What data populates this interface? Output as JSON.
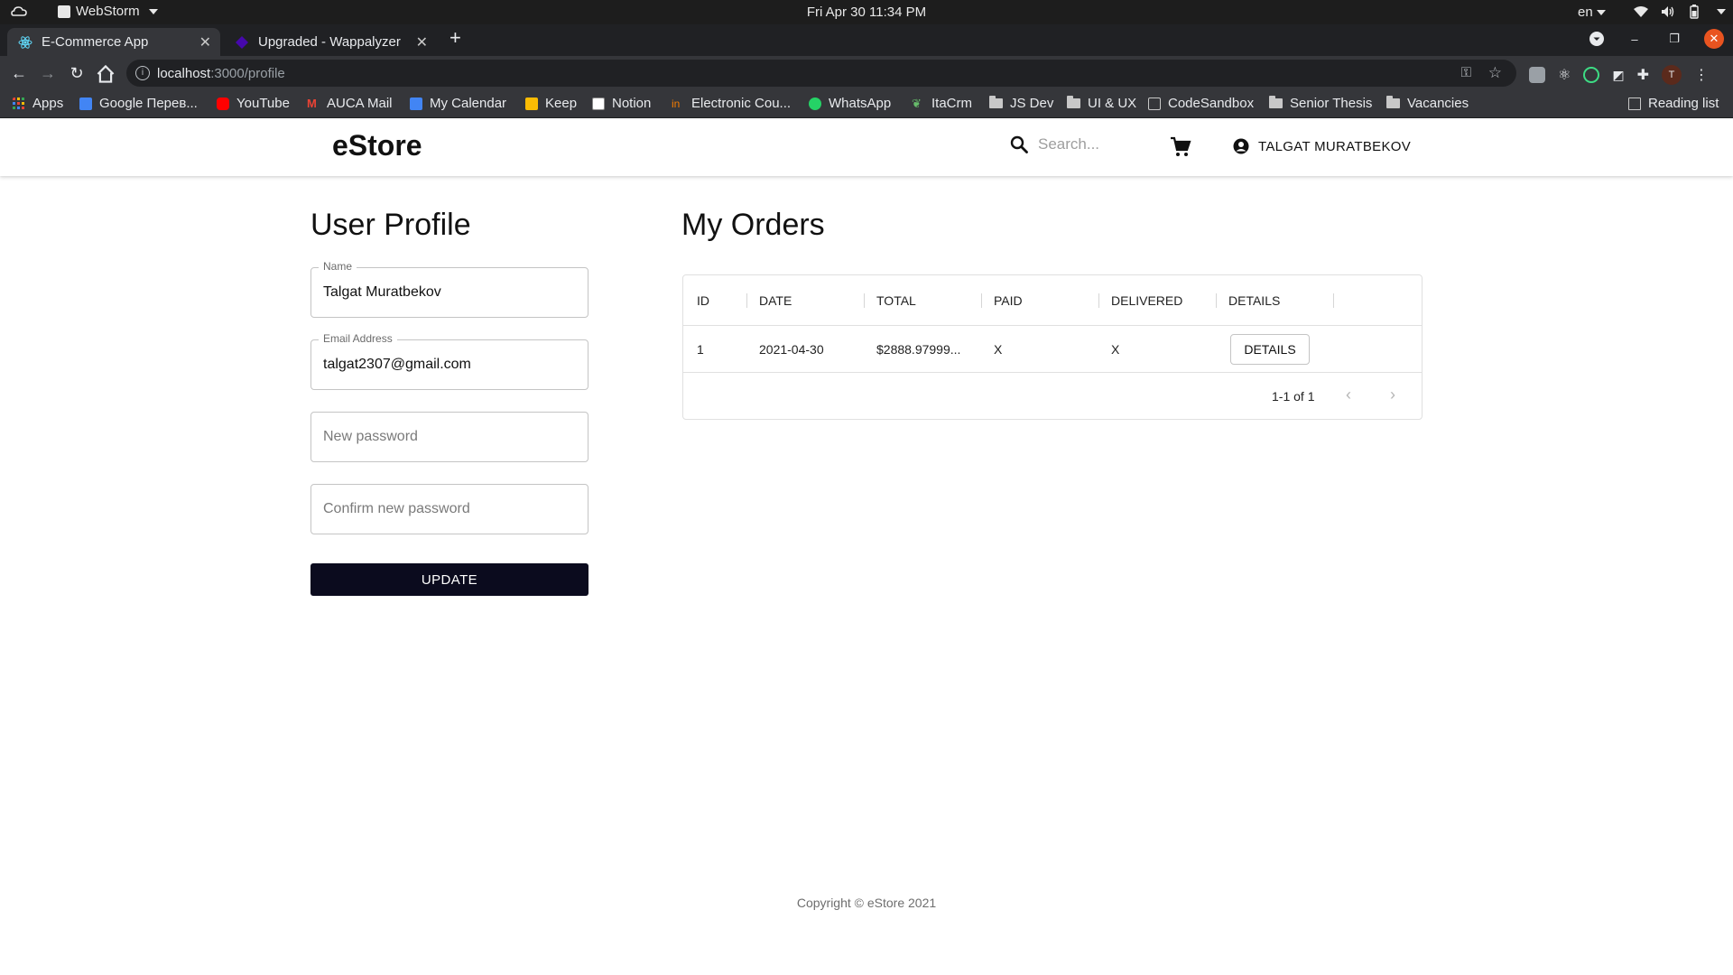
{
  "os": {
    "app_name": "WebStorm",
    "clock": "Fri Apr 30  11:34 PM",
    "lang": "en"
  },
  "browser": {
    "tabs": [
      {
        "title": "E-Commerce App",
        "active": true
      },
      {
        "title": "Upgraded - Wappalyzer",
        "active": false
      }
    ],
    "new_tab": "+",
    "url_host": "localhost",
    "url_path": ":3000/profile",
    "bookmarks": [
      {
        "label": "Apps",
        "icon": "apps-grid-icon"
      },
      {
        "label": "Google Перев...",
        "icon": "google-translate-icon"
      },
      {
        "label": "YouTube",
        "icon": "youtube-icon"
      },
      {
        "label": "AUCA Mail",
        "icon": "gmail-icon"
      },
      {
        "label": "My Calendar",
        "icon": "calendar-icon"
      },
      {
        "label": "Keep",
        "icon": "keep-icon"
      },
      {
        "label": "Notion",
        "icon": "notion-icon"
      },
      {
        "label": "Electronic Cou...",
        "icon": "course-icon"
      },
      {
        "label": "WhatsApp",
        "icon": "whatsapp-icon"
      },
      {
        "label": "ItaCrm",
        "icon": "leaf-icon"
      },
      {
        "label": "JS Dev",
        "icon": "folder-icon"
      },
      {
        "label": "UI & UX",
        "icon": "folder-icon"
      },
      {
        "label": "CodeSandbox",
        "icon": "codesandbox-icon"
      },
      {
        "label": "Senior Thesis",
        "icon": "folder-icon"
      },
      {
        "label": "Vacancies",
        "icon": "folder-icon"
      }
    ],
    "reading_list": "Reading list"
  },
  "header": {
    "brand": "eStore",
    "search_placeholder": "Search...",
    "user_name": "TALGAT MURATBEKOV"
  },
  "profile": {
    "title": "User Profile",
    "name_label": "Name",
    "name_value": "Talgat Muratbekov",
    "email_label": "Email Address",
    "email_value": "talgat2307@gmail.com",
    "new_password_placeholder": "New password",
    "confirm_password_placeholder": "Confirm new password",
    "update_label": "UPDATE"
  },
  "orders": {
    "title": "My Orders",
    "columns": [
      "ID",
      "DATE",
      "TOTAL",
      "PAID",
      "DELIVERED",
      "DETAILS"
    ],
    "rows": [
      {
        "id": "1",
        "date": "2021-04-30",
        "total": "$2888.97999...",
        "paid": "X",
        "delivered": "X",
        "details": "DETAILS"
      }
    ],
    "pagination": "1-1 of 1"
  },
  "footer": {
    "copyright": "Copyright © eStore 2021"
  },
  "colors": {
    "primary_button": "#0b0b1e",
    "browser_dark": "#202124",
    "browser_toolbar": "#35363a",
    "close_button": "#e95420"
  }
}
